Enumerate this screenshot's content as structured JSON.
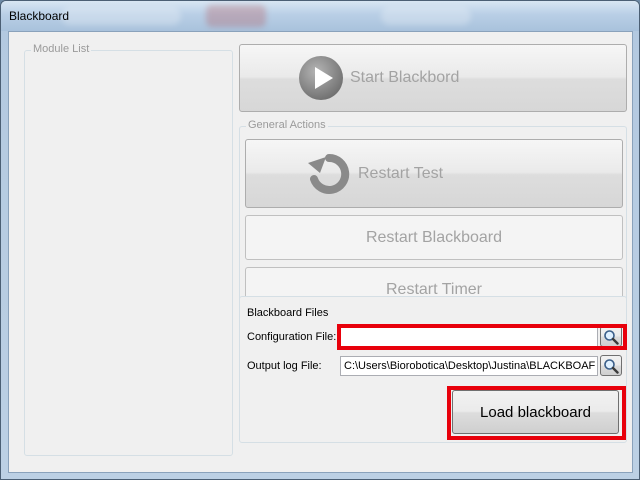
{
  "window": {
    "title": "Blackboard"
  },
  "module_list": {
    "legend": "Module List"
  },
  "start_button": {
    "label": "Start Blackbord",
    "icon": "play-icon"
  },
  "general_actions": {
    "legend": "General Actions",
    "restart_test_label": "Restart Test",
    "restart_test_icon": "refresh-icon",
    "restart_blackboard_label": "Restart Blackboard",
    "restart_timer_label": "Restart Timer"
  },
  "blackboard_files": {
    "legend": "Blackboard Files",
    "config_label": "Configuration File:",
    "config_value": "",
    "output_label": "Output log File:",
    "output_value": "C:\\Users\\Biorobotica\\Desktop\\Justina\\BLACKBOAF",
    "browse_icon": "magnifier-icon",
    "load_label": "Load blackboard"
  },
  "colors": {
    "highlight": "#e8000b",
    "disabled_text": "#a3a3a3"
  }
}
